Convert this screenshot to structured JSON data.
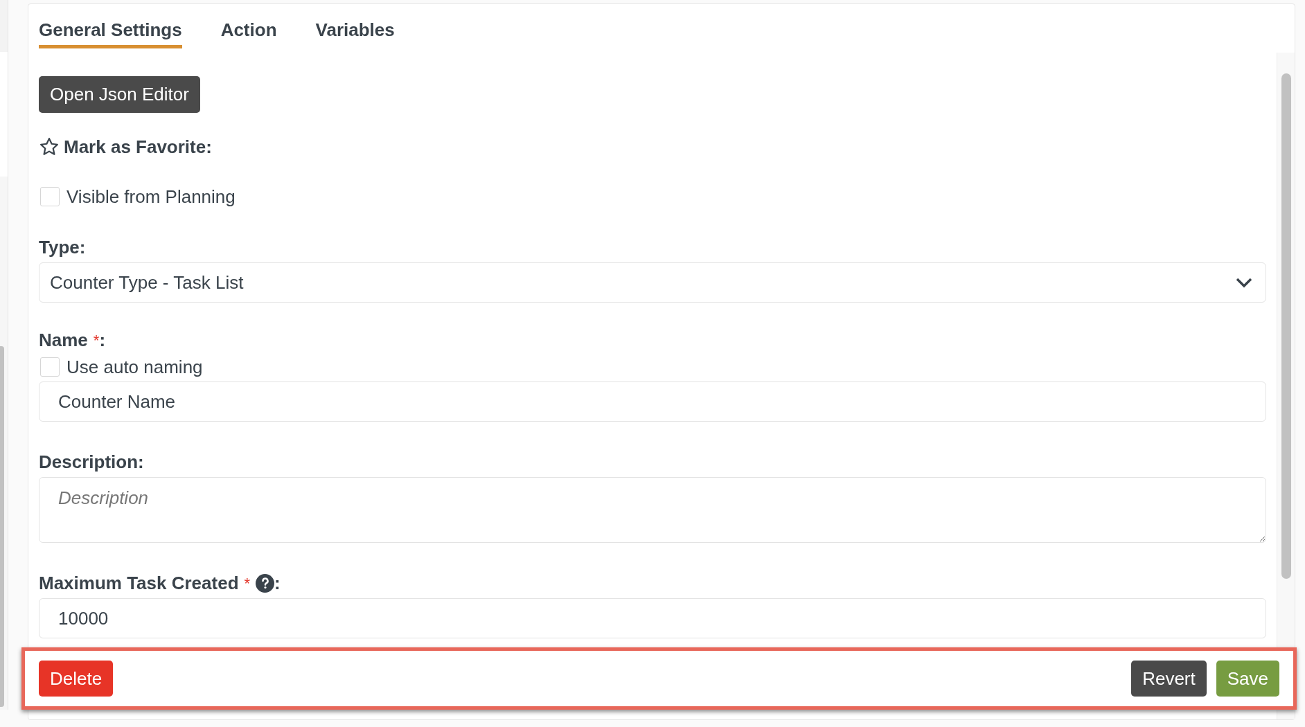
{
  "tabs": [
    {
      "label": "General Settings",
      "selected": true
    },
    {
      "label": "Action",
      "selected": false
    },
    {
      "label": "Variables",
      "selected": false
    }
  ],
  "json_editor_button": "Open Json Editor",
  "favorite": {
    "label": "Mark as Favorite:",
    "starred": false
  },
  "visible_from_planning": {
    "label": "Visible from Planning",
    "checked": false
  },
  "fields": [
    {
      "kind": "select",
      "label": "Type",
      "colon": ":",
      "value": "Counter Type - Task List"
    },
    {
      "kind": "text",
      "label": "Name",
      "required_mark": "*",
      "colon": ":",
      "checkbox": {
        "label": "Use auto naming",
        "checked": false
      },
      "value": "Counter Name"
    },
    {
      "kind": "textarea",
      "label": "Description",
      "colon": ":",
      "placeholder": "Description"
    },
    {
      "kind": "text",
      "label": "Maximum Task Created",
      "required_mark": "*",
      "help": true,
      "colon": ":",
      "value": "10000"
    }
  ],
  "footer": {
    "delete": "Delete",
    "revert": "Revert",
    "save": "Save"
  }
}
